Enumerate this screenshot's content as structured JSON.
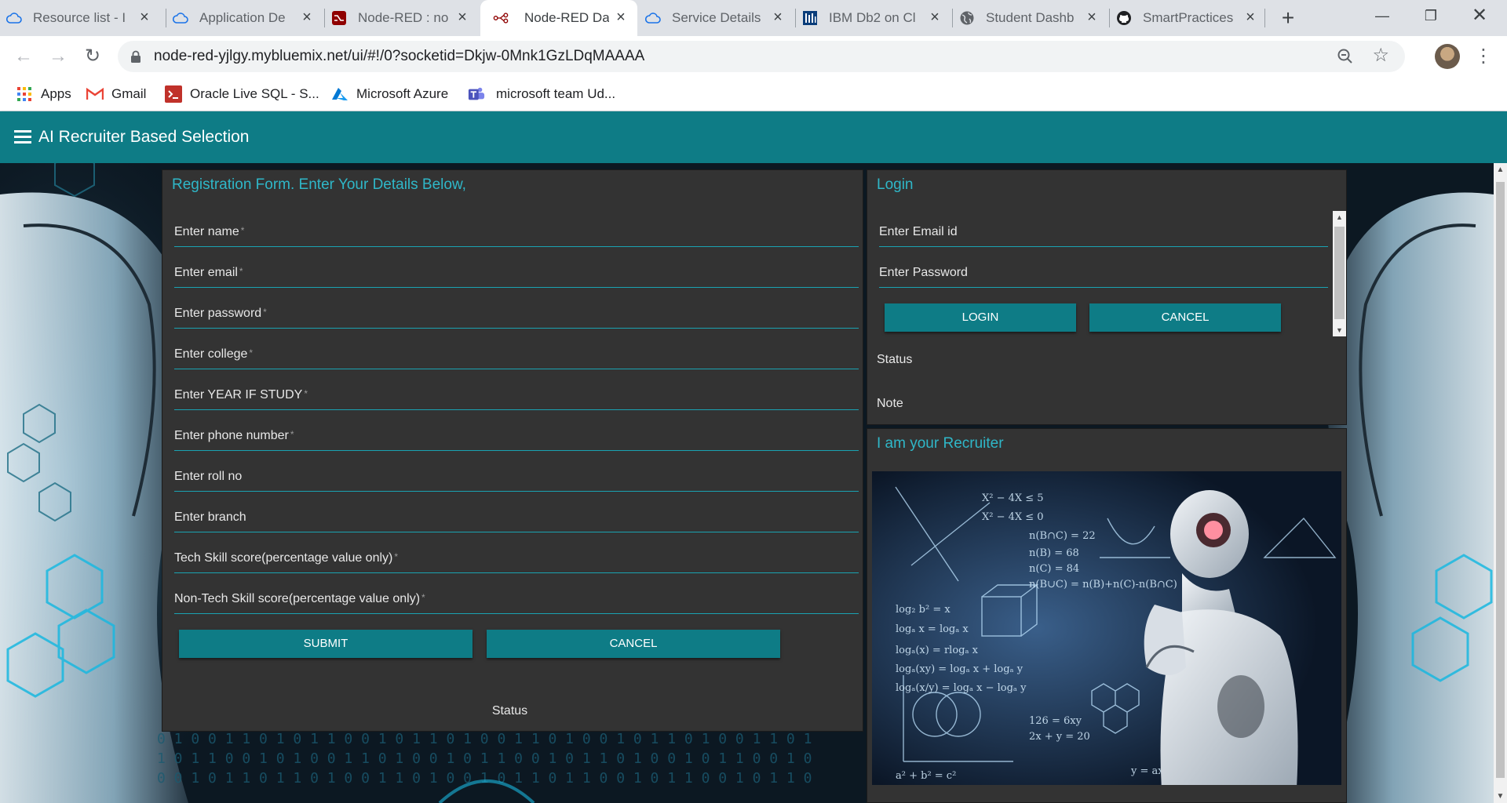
{
  "browser": {
    "tabs": [
      {
        "title": "Resource list - I",
        "icon": "ibm-cloud-icon"
      },
      {
        "title": "Application De",
        "icon": "ibm-cloud-icon"
      },
      {
        "title": "Node-RED : no",
        "icon": "node-red-icon"
      },
      {
        "title": "Node-RED Das",
        "icon": "node-red-dashboard-icon"
      },
      {
        "title": "Service Details",
        "icon": "ibm-cloud-icon"
      },
      {
        "title": "IBM Db2 on Cl",
        "icon": "db2-icon"
      },
      {
        "title": "Student Dashb",
        "icon": "globe-icon"
      },
      {
        "title": "SmartPractices",
        "icon": "github-icon"
      }
    ],
    "active_tab_index": 3,
    "url": "node-red-yjlgy.mybluemix.net/ui/#!/0?socketid=Dkjw-0Mnk1GzLDqMAAAA",
    "bookmarks": [
      {
        "label": "Apps",
        "icon": "apps-grid-icon"
      },
      {
        "label": "Gmail",
        "icon": "gmail-icon"
      },
      {
        "label": "Oracle Live SQL - S...",
        "icon": "oracle-sql-icon"
      },
      {
        "label": "Microsoft Azure",
        "icon": "azure-icon"
      },
      {
        "label": "microsoft team Ud...",
        "icon": "teams-icon"
      }
    ]
  },
  "app": {
    "title": "AI Recruiter Based Selection",
    "accent": "#0e7c86",
    "title_color": "#2fb7c8"
  },
  "registration": {
    "title": "Registration Form. Enter Your Details Below,",
    "fields": [
      {
        "label": "Enter name",
        "required_mark": "*"
      },
      {
        "label": "Enter email",
        "required_mark": "*"
      },
      {
        "label": "Enter password",
        "required_mark": "*"
      },
      {
        "label": "Enter college",
        "required_mark": "*"
      },
      {
        "label": "Enter YEAR IF STUDY",
        "required_mark": "*"
      },
      {
        "label": "Enter phone number",
        "required_mark": "*"
      },
      {
        "label": "Enter roll no",
        "required_mark": ""
      },
      {
        "label": "Enter branch",
        "required_mark": ""
      },
      {
        "label": "Tech Skill score(percentage value only)",
        "required_mark": "*"
      },
      {
        "label": "Non-Tech Skill score(percentage value only)",
        "required_mark": "*"
      }
    ],
    "submit_label": "SUBMIT",
    "cancel_label": "CANCEL",
    "status_label": "Status"
  },
  "login": {
    "title": "Login",
    "email_label": "Enter Email id",
    "password_label": "Enter Password",
    "login_label": "LOGIN",
    "cancel_label": "CANCEL",
    "status_label": "Status",
    "note_label": "Note"
  },
  "recruiter": {
    "title": "I am your Recruiter"
  }
}
